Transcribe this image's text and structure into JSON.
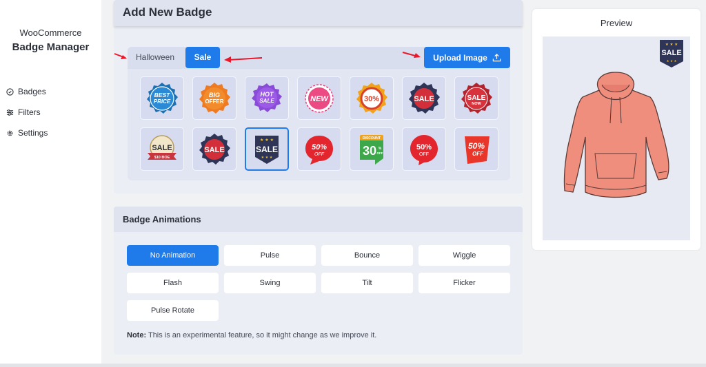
{
  "sidebar": {
    "brand_line1": "WooCommerce",
    "brand_line2": "Badge Manager",
    "items": [
      {
        "label": "Badges",
        "icon": "badge-icon"
      },
      {
        "label": "Filters",
        "icon": "sliders-icon"
      },
      {
        "label": "Settings",
        "icon": "gear-icon"
      }
    ]
  },
  "add_badge": {
    "title": "Add New Badge",
    "tabs": [
      {
        "label": "Halloween",
        "active": false
      },
      {
        "label": "Sale",
        "active": true
      }
    ],
    "upload_label": "Upload Image",
    "selected_index": 9,
    "badges": [
      {
        "name": "best-price",
        "text": "BEST PRICE"
      },
      {
        "name": "big-offer",
        "text": "BIG OFFER"
      },
      {
        "name": "hot-sale",
        "text": "HOT SALE"
      },
      {
        "name": "new",
        "text": "NEW"
      },
      {
        "name": "30-percent",
        "text": "30%"
      },
      {
        "name": "sale-dark",
        "text": "SALE"
      },
      {
        "name": "sale-now",
        "text": "SALE NOW"
      },
      {
        "name": "sale-ribbon",
        "text": "SALE",
        "sub": "$10 BOE"
      },
      {
        "name": "sale-seal",
        "text": "SALE"
      },
      {
        "name": "sale-shield",
        "text": "SALE"
      },
      {
        "name": "50-off-bubble",
        "text": "50%",
        "sub": "OFF"
      },
      {
        "name": "discount-30",
        "text": "30",
        "sub": "DISCOUNT"
      },
      {
        "name": "50-off-circle",
        "text": "50%",
        "sub": "OFF"
      },
      {
        "name": "50-off-tag",
        "text": "50%",
        "sub": "OFF"
      }
    ]
  },
  "preview": {
    "title": "Preview",
    "badge_text": "SALE"
  },
  "animations": {
    "title": "Badge Animations",
    "options": [
      "No Animation",
      "Pulse",
      "Bounce",
      "Wiggle",
      "Flash",
      "Swing",
      "Tilt",
      "Flicker",
      "Pulse Rotate"
    ],
    "active": "No Animation",
    "note_label": "Note:",
    "note_text": "This is an experimental feature, so it might change as we improve it."
  },
  "colors": {
    "accent": "#1f7bea",
    "annotation_arrow": "#e8182a"
  }
}
